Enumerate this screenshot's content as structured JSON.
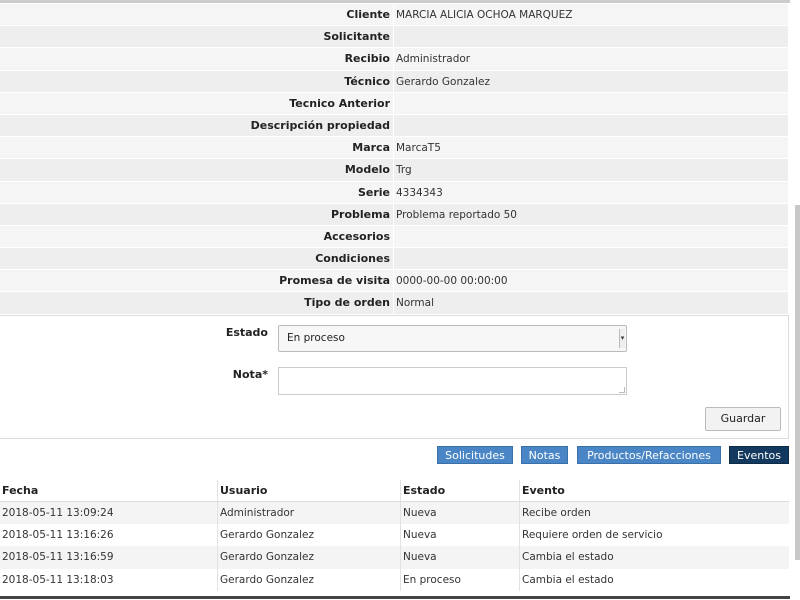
{
  "info_rows": [
    {
      "label": "Cliente",
      "value": "MARCIA ALICIA OCHOA MARQUEZ"
    },
    {
      "label": "Solicitante",
      "value": ""
    },
    {
      "label": "Recibio",
      "value": "Administrador"
    },
    {
      "label": "Técnico",
      "value": "Gerardo Gonzalez"
    },
    {
      "label": "Tecnico Anterior",
      "value": ""
    },
    {
      "label": "Descripción propiedad",
      "value": ""
    },
    {
      "label": "Marca",
      "value": "MarcaT5"
    },
    {
      "label": "Modelo",
      "value": "Trg"
    },
    {
      "label": "Serie",
      "value": "4334343"
    },
    {
      "label": "Problema",
      "value": "Problema reportado 50"
    },
    {
      "label": "Accesorios",
      "value": ""
    },
    {
      "label": "Condiciones",
      "value": ""
    },
    {
      "label": "Promesa de visita",
      "value": "0000-00-00 00:00:00"
    },
    {
      "label": "Tipo de orden",
      "value": "Normal"
    }
  ],
  "form": {
    "estado_label": "Estado",
    "estado_value": "En proceso",
    "nota_label": "Nota*",
    "nota_value": "",
    "guardar_label": "Guardar"
  },
  "tabs": {
    "solicitudes": "Solicitudes",
    "notas": "Notas",
    "productos": "Productos/Refacciones",
    "eventos": "Eventos"
  },
  "events": {
    "headers": [
      "Fecha",
      "Usuario",
      "Estado",
      "Evento"
    ],
    "rows": [
      [
        "2018-05-11 13:09:24",
        "Administrador",
        "Nueva",
        "Recibe orden"
      ],
      [
        "2018-05-11 13:16:26",
        "Gerardo Gonzalez",
        "Nueva",
        "Requiere orden de servicio"
      ],
      [
        "2018-05-11 13:16:59",
        "Gerardo Gonzalez",
        "Nueva",
        "Cambia el estado"
      ],
      [
        "2018-05-11 13:18:03",
        "Gerardo Gonzalez",
        "En proceso",
        "Cambia el estado"
      ]
    ]
  },
  "colors": {
    "tab_blue": "#4a86c5",
    "tab_active": "#13395f"
  }
}
